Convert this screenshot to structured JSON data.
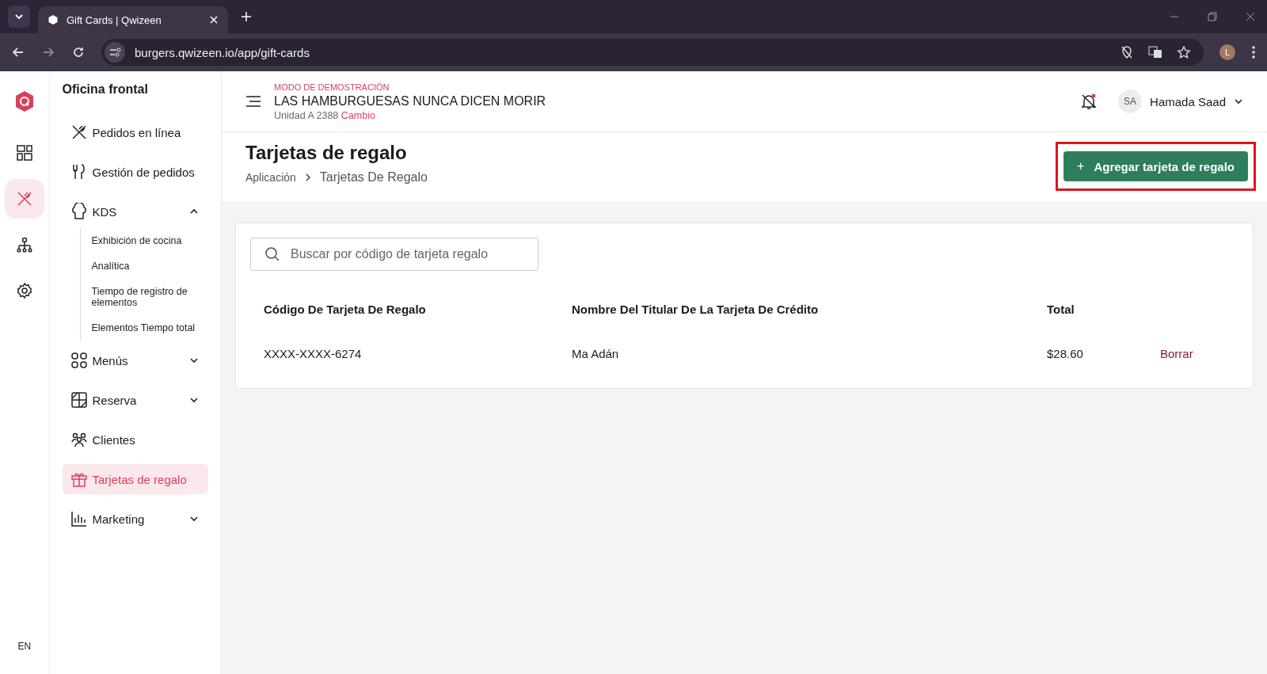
{
  "browser": {
    "tabs": [
      {
        "title": "Gift Cards | Qwizeen",
        "selected": true
      }
    ],
    "url": "burgers.qwizeen.io/app/gift-cards",
    "profile_initial": "L"
  },
  "rail": {
    "items": [
      {
        "kind": "grid",
        "selected": false
      },
      {
        "kind": "utensils",
        "selected": true
      },
      {
        "kind": "hierarchy",
        "selected": false
      },
      {
        "kind": "gear",
        "selected": false
      }
    ],
    "language": "EN"
  },
  "sidebar": {
    "title": "Oficina frontal",
    "items": [
      {
        "kind": "utensils",
        "label": "Pedidos en línea",
        "selected": false
      },
      {
        "kind": "fork",
        "label": "Gestión de pedidos",
        "selected": false
      },
      {
        "kind": "chef",
        "label": "KDS",
        "selected": false,
        "expanded": true,
        "children": [
          {
            "label": "Exhibición de cocina"
          },
          {
            "label": "Analítica"
          },
          {
            "label": "Tiempo de registro de elementos"
          },
          {
            "label": "Elementos Tiempo total"
          }
        ]
      },
      {
        "kind": "menus",
        "label": "Menús",
        "selected": false,
        "expanded": false
      },
      {
        "kind": "reserve",
        "label": "Reserva",
        "selected": false,
        "expanded": false
      },
      {
        "kind": "people",
        "label": "Clientes",
        "selected": false
      },
      {
        "kind": "gift",
        "label": "Tarjetas de regalo",
        "selected": true
      },
      {
        "kind": "chart",
        "label": "Marketing",
        "selected": false,
        "expanded": false
      }
    ]
  },
  "header": {
    "mode": "MODO DE DEMOSTRACIÓN",
    "restaurant": "LAS HAMBURGUESAS NUNCA DICEN MORIR",
    "unit": "Unidad A 2388",
    "change_link": "Cambio",
    "user_initials": "SA",
    "user_name": "Hamada Saad"
  },
  "page": {
    "title": "Tarjetas de regalo",
    "breadcrumb": [
      "Aplicación",
      "Tarjetas De Regalo"
    ],
    "add_button": "Agregar tarjeta de regalo",
    "add_button_icon": "+"
  },
  "search": {
    "placeholder": "Buscar por código de tarjeta regalo"
  },
  "table": {
    "columns": [
      "Código De Tarjeta De Regalo",
      "Nombre Del Titular De La Tarjeta De Crédito",
      "Total"
    ],
    "rows": [
      {
        "code": "XXXX-XXXX-6274",
        "holder": "Ma Adán",
        "total": "$28.60",
        "action": "Borrar"
      }
    ]
  }
}
